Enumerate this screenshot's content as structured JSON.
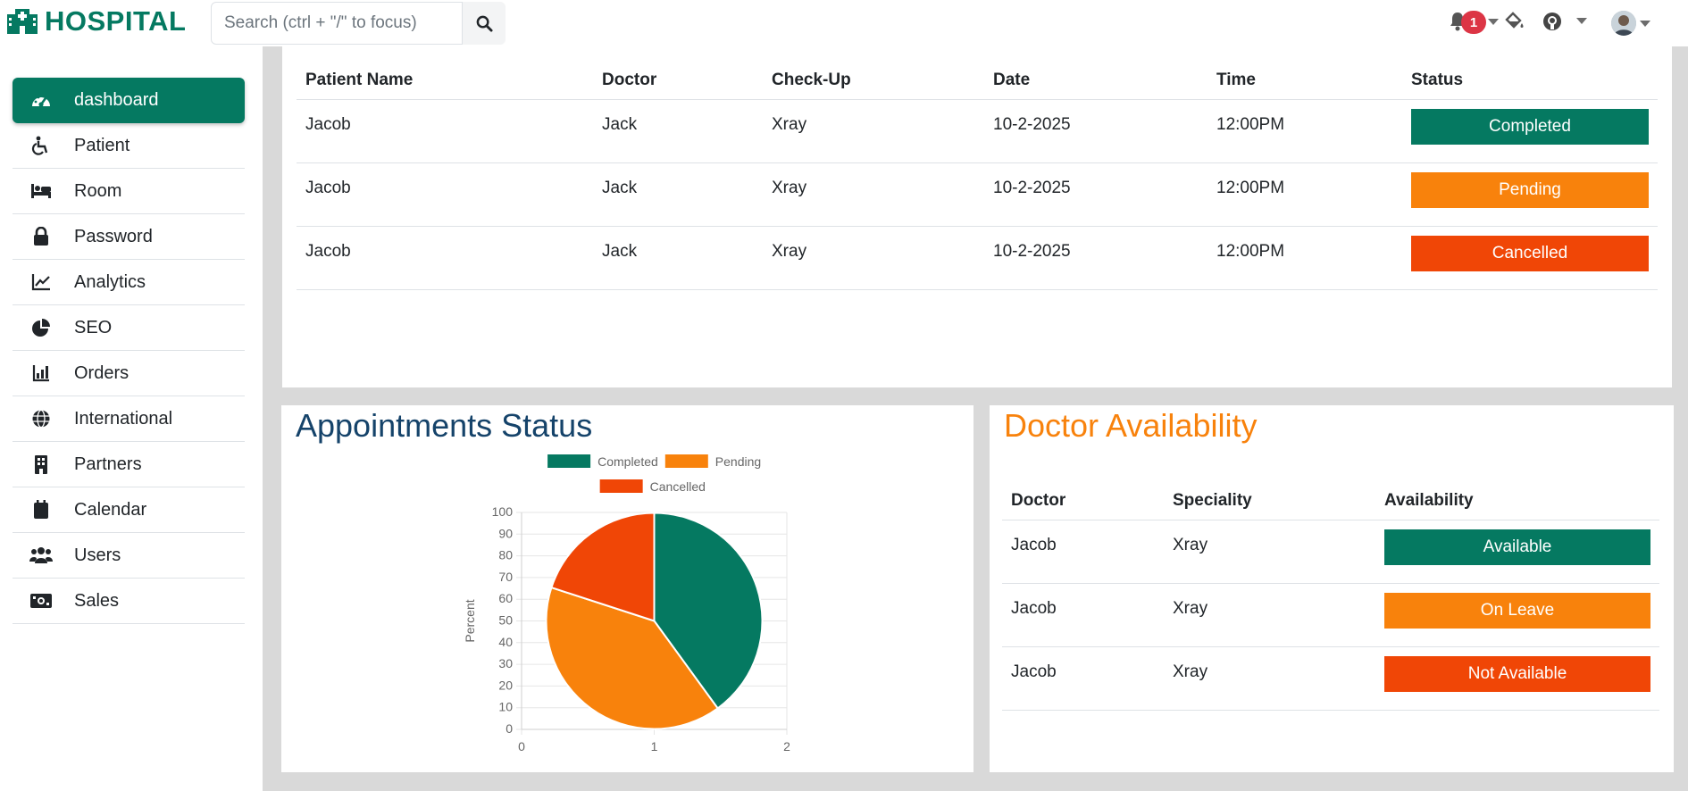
{
  "header": {
    "brand": "HOSPITAL",
    "search_placeholder": "Search (ctrl + \"/\" to focus)",
    "notifications_count": "1"
  },
  "sidebar": {
    "items": [
      {
        "label": "dashboard",
        "icon": "gauge-icon",
        "active": true
      },
      {
        "label": "Patient",
        "icon": "wheelchair-icon"
      },
      {
        "label": "Room",
        "icon": "bed-icon"
      },
      {
        "label": "Password",
        "icon": "lock-icon"
      },
      {
        "label": "Analytics",
        "icon": "line-chart-icon"
      },
      {
        "label": "SEO",
        "icon": "pie-chart-icon"
      },
      {
        "label": "Orders",
        "icon": "bar-chart-icon"
      },
      {
        "label": "International",
        "icon": "globe-icon"
      },
      {
        "label": "Partners",
        "icon": "building-icon"
      },
      {
        "label": "Calendar",
        "icon": "calendar-icon"
      },
      {
        "label": "Users",
        "icon": "users-icon"
      },
      {
        "label": "Sales",
        "icon": "money-icon"
      }
    ]
  },
  "appointments_table": {
    "headers": [
      "Patient Name",
      "Doctor",
      "Check-Up",
      "Date",
      "Time",
      "Status"
    ],
    "rows": [
      {
        "patient": "Jacob",
        "doctor": "Jack",
        "checkup": "Xray",
        "date": "10-2-2025",
        "time": "12:00PM",
        "status": "Completed"
      },
      {
        "patient": "Jacob",
        "doctor": "Jack",
        "checkup": "Xray",
        "date": "10-2-2025",
        "time": "12:00PM",
        "status": "Pending"
      },
      {
        "patient": "Jacob",
        "doctor": "Jack",
        "checkup": "Xray",
        "date": "10-2-2025",
        "time": "12:00PM",
        "status": "Cancelled"
      }
    ]
  },
  "appointments_status": {
    "title": "Appointments Status"
  },
  "doctor_availability": {
    "title": "Doctor Availability",
    "headers": [
      "Doctor",
      "Speciality",
      "Availability"
    ],
    "rows": [
      {
        "doctor": "Jacob",
        "speciality": "Xray",
        "availability": "Available"
      },
      {
        "doctor": "Jacob",
        "speciality": "Xray",
        "availability": "On Leave"
      },
      {
        "doctor": "Jacob",
        "speciality": "Xray",
        "availability": "Not Available"
      }
    ]
  },
  "colors": {
    "brand": "#057961",
    "completed": "#057961",
    "pending": "#f8820c",
    "cancelled": "#f04606",
    "title_blue": "#15436a"
  },
  "chart_data": {
    "type": "pie",
    "title": "",
    "legend": [
      "Completed",
      "Pending",
      "Cancelled"
    ],
    "legend_position": "top",
    "values": [
      40,
      40,
      20
    ],
    "colors": [
      "#057961",
      "#f8820c",
      "#f04606"
    ],
    "ylabel": "Percent",
    "ylim": [
      0,
      100
    ],
    "yticks": [
      "0",
      "10",
      "20",
      "30",
      "40",
      "50",
      "60",
      "70",
      "80",
      "90",
      "100"
    ],
    "xlim": [
      0,
      2
    ],
    "xticks": [
      "0",
      "1",
      "2"
    ],
    "grid": true
  }
}
